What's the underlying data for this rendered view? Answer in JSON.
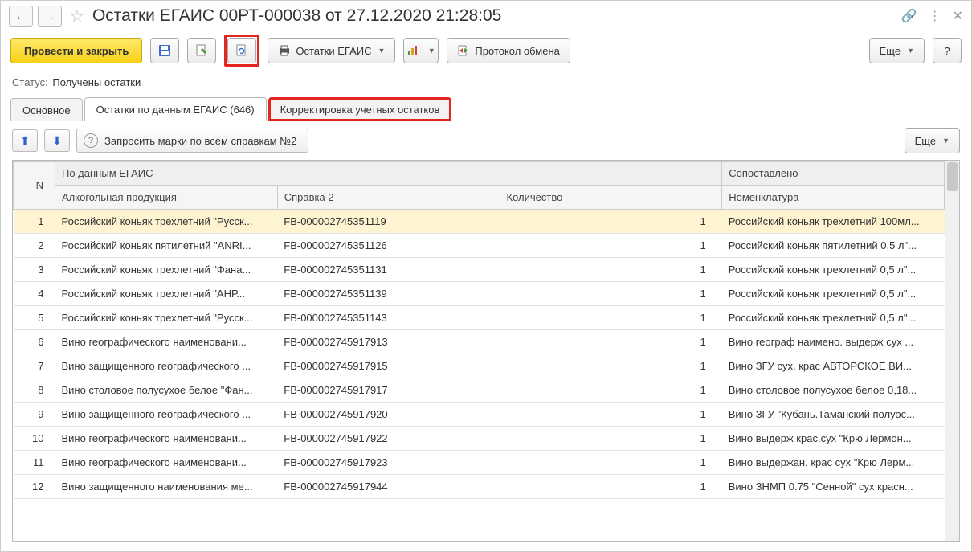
{
  "title": "Остатки ЕГАИС 00РТ-000038 от 27.12.2020 21:28:05",
  "toolbar": {
    "submit_close": "Провести и закрыть",
    "print_label": "Остатки ЕГАИС",
    "protocol": "Протокол обмена",
    "more": "Еще",
    "help": "?"
  },
  "status": {
    "label": "Статус:",
    "value": "Получены остатки"
  },
  "tabs": {
    "main": "Основное",
    "egais": "Остатки по данным ЕГАИС (646)",
    "correction": "Корректировка учетных остатков"
  },
  "subtoolbar": {
    "query": "Запросить марки по всем справкам №2",
    "more": "Еще"
  },
  "table": {
    "headers": {
      "n": "N",
      "group1": "По данным ЕГАИС",
      "group2": "Сопоставлено",
      "product": "Алкогольная продукция",
      "ref": "Справка 2",
      "qty": "Количество",
      "nom": "Номенклатура"
    },
    "rows": [
      {
        "n": "1",
        "product": "Российский коньяк трехлетний \"Русск...",
        "ref": "FB-000002745351119",
        "qty": "1",
        "nom": "Российский коньяк трехлетний 100мл..."
      },
      {
        "n": "2",
        "product": "Российский коньяк пятилетний \"ANRI...",
        "ref": "FB-000002745351126",
        "qty": "1",
        "nom": "Российский коньяк пятилетний 0,5 л\"..."
      },
      {
        "n": "3",
        "product": "Российский коньяк трехлетний \"Фана...",
        "ref": "FB-000002745351131",
        "qty": "1",
        "nom": "Российский коньяк трехлетний 0,5 л\"..."
      },
      {
        "n": "4",
        "product": "Российский коньяк трехлетний \"АНР...",
        "ref": "FB-000002745351139",
        "qty": "1",
        "nom": "Российский коньяк трехлетний 0,5 л\"..."
      },
      {
        "n": "5",
        "product": "Российский коньяк трехлетний \"Русск...",
        "ref": "FB-000002745351143",
        "qty": "1",
        "nom": "Российский коньяк трехлетний 0,5 л\"..."
      },
      {
        "n": "6",
        "product": "Вино географического наименовани...",
        "ref": "FB-000002745917913",
        "qty": "1",
        "nom": "Вино географ наимено. выдерж сух ..."
      },
      {
        "n": "7",
        "product": "Вино защищенного географического ...",
        "ref": "FB-000002745917915",
        "qty": "1",
        "nom": "Вино ЗГУ сух. крас АВТОРСКОЕ ВИ..."
      },
      {
        "n": "8",
        "product": "Вино столовое полусухое белое \"Фан...",
        "ref": "FB-000002745917917",
        "qty": "1",
        "nom": "Вино столовое полусухое белое 0,18..."
      },
      {
        "n": "9",
        "product": "Вино защищенного географического ...",
        "ref": "FB-000002745917920",
        "qty": "1",
        "nom": "Вино ЗГУ \"Кубань.Таманский полуос..."
      },
      {
        "n": "10",
        "product": "Вино географического наименовани...",
        "ref": "FB-000002745917922",
        "qty": "1",
        "nom": "Вино выдерж крас.сух \"Крю Лермон..."
      },
      {
        "n": "11",
        "product": "Вино географического наименовани...",
        "ref": "FB-000002745917923",
        "qty": "1",
        "nom": "Вино выдержан. крас сух \"Крю Лерм..."
      },
      {
        "n": "12",
        "product": "Вино защищенного наименования ме...",
        "ref": "FB-000002745917944",
        "qty": "1",
        "nom": "Вино ЗНМП 0.75 \"Сенной\" сух красн..."
      }
    ]
  }
}
